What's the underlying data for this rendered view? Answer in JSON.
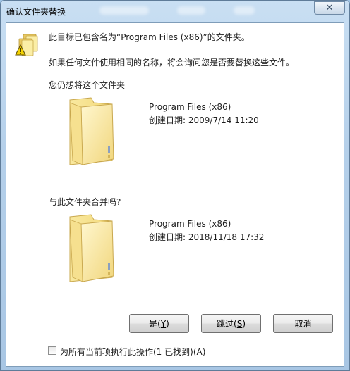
{
  "window": {
    "title": "确认文件夹替换",
    "close_glyph": "✕"
  },
  "message": {
    "line1": "此目标已包含名为“Program Files (x86)”的文件夹。",
    "line2": "如果任何文件使用相同的名称，将会询问您是否要替换这些文件。",
    "prompt": "您仍想将这个文件夹"
  },
  "target_folder": {
    "icon": "folder-icon",
    "name": "Program Files (x86)",
    "created": "创建日期: 2009/7/14 11:20"
  },
  "merge_question": "与此文件夹合并吗?",
  "source_folder": {
    "icon": "folder-icon",
    "name": "Program Files (x86)",
    "created": "创建日期: 2018/11/18 17:32"
  },
  "buttons": {
    "yes_text": "是(",
    "yes_key": "Y",
    "yes_end": ")",
    "skip_text": "跳过(",
    "skip_key": "S",
    "skip_end": ")",
    "cancel": "取消"
  },
  "apply_all": {
    "checked": false,
    "label_text": "为所有当前项执行此操作(1 已找到)(",
    "label_key": "A",
    "label_end": ")"
  },
  "colors": {
    "folder_light": "#fbeea6",
    "folder_dark": "#e8c863",
    "titlebar": "#b5d0ea",
    "footer": "#f0f0f0"
  }
}
